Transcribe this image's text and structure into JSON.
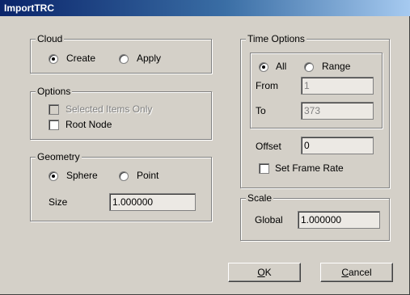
{
  "title": "ImportTRC",
  "cloud": {
    "legend": "Cloud",
    "options": [
      {
        "label": "Create",
        "selected": true
      },
      {
        "label": "Apply",
        "selected": false
      }
    ]
  },
  "options": {
    "legend": "Options",
    "selected_items_only": {
      "label": "Selected Items Only",
      "checked": false,
      "enabled": false
    },
    "root_node": {
      "label": "Root Node",
      "checked": false,
      "enabled": true
    }
  },
  "geometry": {
    "legend": "Geometry",
    "options": [
      {
        "label": "Sphere",
        "selected": true
      },
      {
        "label": "Point",
        "selected": false
      }
    ],
    "size_label": "Size",
    "size_value": "1.000000"
  },
  "time_options": {
    "legend": "Time Options",
    "options": [
      {
        "label": "All",
        "selected": true
      },
      {
        "label": "Range",
        "selected": false
      }
    ],
    "from_label": "From",
    "from_value": "1",
    "to_label": "To",
    "to_value": "373",
    "offset_label": "Offset",
    "offset_value": "0",
    "set_frame_rate": {
      "label": "Set Frame Rate",
      "checked": false
    }
  },
  "scale": {
    "legend": "Scale",
    "global_label": "Global",
    "global_value": "1.000000"
  },
  "buttons": {
    "ok_prefix": "O",
    "ok_rest": "K",
    "cancel_prefix": "C",
    "cancel_rest": "ancel"
  }
}
